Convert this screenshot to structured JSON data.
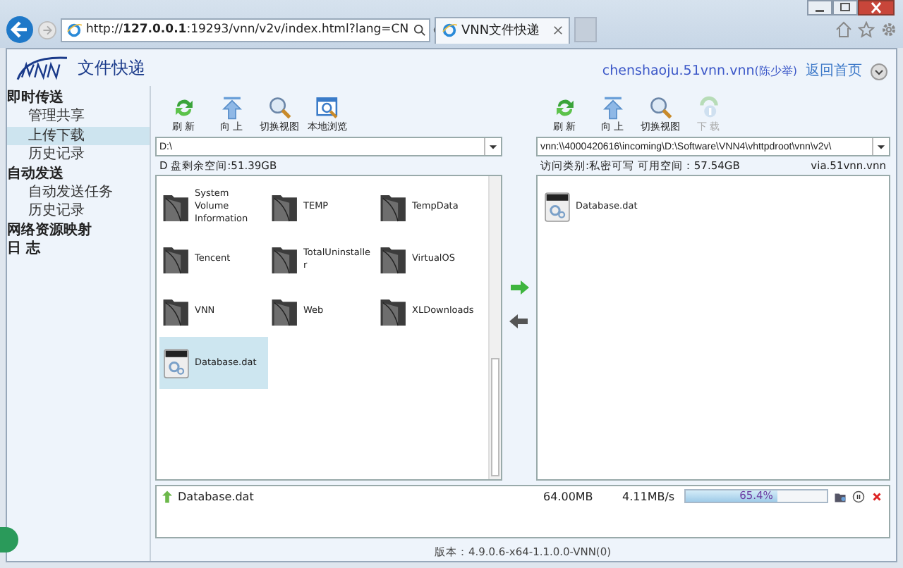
{
  "browser": {
    "address": "http://**127.0.0.1**:19293/vnn/v2v/index.html?lang=CN",
    "tab_title": "VNN文件快递"
  },
  "header": {
    "app_title": "文件快递",
    "user": "chenshaoju.51vnn.vnn",
    "user_note": "(陈少举)",
    "home_link": "返回首页"
  },
  "sidebar": {
    "groups": [
      {
        "label": "即时传送",
        "children": [
          {
            "label": "管理共享",
            "selected": false
          },
          {
            "label": "上传下载",
            "selected": true
          },
          {
            "label": "历史记录",
            "selected": false
          }
        ]
      },
      {
        "label": "自动发送",
        "children": [
          {
            "label": "自动发送任务",
            "selected": false
          },
          {
            "label": "历史记录",
            "selected": false
          }
        ]
      },
      {
        "label": "网络资源映射"
      },
      {
        "label": "日 志"
      }
    ]
  },
  "local_pane": {
    "toolbar": [
      {
        "kind": "refresh",
        "label": "刷 新",
        "disabled": false
      },
      {
        "kind": "up",
        "label": "向 上",
        "disabled": false
      },
      {
        "kind": "view",
        "label": "切换视图",
        "disabled": false
      },
      {
        "kind": "browse",
        "label": "本地浏览",
        "disabled": false
      }
    ],
    "path": "D:\\",
    "info": "D 盘剩余空间:51.39GB",
    "files": [
      {
        "kind": "folder",
        "name": "System Volume Information",
        "selected": false
      },
      {
        "kind": "folder",
        "name": "TEMP",
        "selected": false
      },
      {
        "kind": "folder",
        "name": "TempData",
        "selected": false
      },
      {
        "kind": "folder",
        "name": "Tencent",
        "selected": false
      },
      {
        "kind": "folder",
        "name": "TotalUninstaller",
        "selected": false
      },
      {
        "kind": "folder",
        "name": "VirtualOS",
        "selected": false
      },
      {
        "kind": "folder",
        "name": "VNN",
        "selected": false
      },
      {
        "kind": "folder",
        "name": "Web",
        "selected": false
      },
      {
        "kind": "folder",
        "name": "XLDownloads",
        "selected": false
      },
      {
        "kind": "file",
        "name": "Database.dat",
        "selected": true
      }
    ]
  },
  "remote_pane": {
    "toolbar": [
      {
        "kind": "refresh",
        "label": "刷 新",
        "disabled": false
      },
      {
        "kind": "up",
        "label": "向 上",
        "disabled": false
      },
      {
        "kind": "view",
        "label": "切换视图",
        "disabled": false
      },
      {
        "kind": "download",
        "label": "下 载",
        "disabled": true
      }
    ],
    "path": "vnn:\\\\4000420616\\incoming\\D:\\Software\\VNN4\\vhttpdroot\\vnn\\v2v\\",
    "info": "访问类别:私密可写  可用空间：57.54GB",
    "via": "via.51vnn.vnn",
    "files": [
      {
        "kind": "file",
        "name": "Database.dat",
        "selected": false
      }
    ]
  },
  "transfers": [
    {
      "name": "Database.dat",
      "size": "64.00MB",
      "speed": "4.11MB/s",
      "level": 0.654,
      "progress_text": "65.4%"
    }
  ],
  "footer": {
    "version": "版本：4.9.0.6-x64-1.1.0.0-VNN(0)"
  }
}
